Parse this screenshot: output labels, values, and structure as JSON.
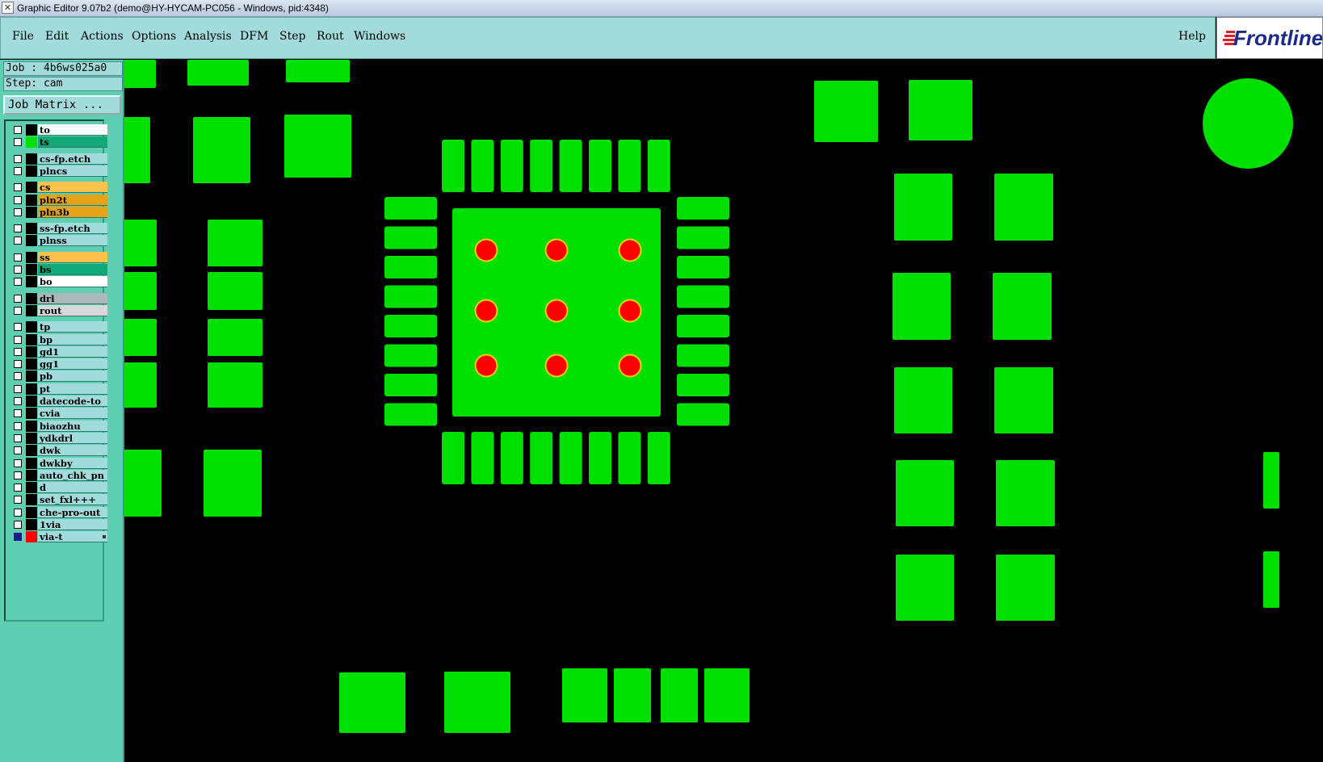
{
  "window": {
    "title": "Graphic Editor 9.07b2 (demo@HY-HYCAM-PC056 - Windows, pid:4348)"
  },
  "menubar": {
    "items": [
      "File",
      "Edit",
      "Actions",
      "Options",
      "Analysis",
      "DFM",
      "Step",
      "Rout",
      "Windows"
    ],
    "help": "Help"
  },
  "logo": {
    "text": "Frontline"
  },
  "sidebar": {
    "job_label": "Job :",
    "job_value": "4b6ws025a0",
    "step_label": "Step:",
    "step_value": "cam",
    "job_matrix_button": "Job Matrix ..."
  },
  "layers": [
    {
      "name": "to",
      "color": "#ffffff",
      "checked": false
    },
    {
      "name": "ts",
      "color": "#13a878",
      "checked": false
    },
    {
      "name": "cs-fp.etch",
      "color": "#a1dbdb",
      "checked": false
    },
    {
      "name": "plncs",
      "color": "#a1dbdb",
      "checked": false
    },
    {
      "name": "cs",
      "color": "#ffc34d",
      "checked": false
    },
    {
      "name": "pln2t",
      "color": "#e7a317",
      "checked": false
    },
    {
      "name": "pln3b",
      "color": "#e7a317",
      "checked": false
    },
    {
      "name": "ss-fp.etch",
      "color": "#a1dbdb",
      "checked": false
    },
    {
      "name": "plnss",
      "color": "#a1dbdb",
      "checked": false
    },
    {
      "name": "ss",
      "color": "#ffc34d",
      "checked": false
    },
    {
      "name": "bs",
      "color": "#13a878",
      "checked": false
    },
    {
      "name": "bo",
      "color": "#ffffff",
      "checked": false
    },
    {
      "name": "drl",
      "color": "#a9b8b8",
      "checked": false
    },
    {
      "name": "rout",
      "color": "#d8d8d8",
      "checked": false
    },
    {
      "name": "tp",
      "color": "#a1dbdb",
      "checked": false
    },
    {
      "name": "bp",
      "color": "#a1dbdb",
      "checked": false
    },
    {
      "name": "gd1",
      "color": "#a1dbdb",
      "checked": false
    },
    {
      "name": "gg1",
      "color": "#a1dbdb",
      "checked": false
    },
    {
      "name": "pb",
      "color": "#a1dbdb",
      "checked": false
    },
    {
      "name": "pt",
      "color": "#a1dbdb",
      "checked": false
    },
    {
      "name": "datecode-to",
      "color": "#a1dbdb",
      "checked": false
    },
    {
      "name": "cvia",
      "color": "#a1dbdb",
      "checked": false
    },
    {
      "name": "biaozhu",
      "color": "#a1dbdb",
      "checked": false
    },
    {
      "name": "ydkdrl",
      "color": "#a1dbdb",
      "checked": false
    },
    {
      "name": "dwk",
      "color": "#a1dbdb",
      "checked": false
    },
    {
      "name": "dwkby",
      "color": "#a1dbdb",
      "checked": false
    },
    {
      "name": "auto_chk_pn",
      "color": "#a1dbdb",
      "checked": false
    },
    {
      "name": "d",
      "color": "#a1dbdb",
      "checked": false
    },
    {
      "name": "set_fxl+++",
      "color": "#a1dbdb",
      "checked": false
    },
    {
      "name": "che-pro-out",
      "color": "#a1dbdb",
      "checked": false
    },
    {
      "name": "1via",
      "color": "#a1dbdb",
      "checked": false
    },
    {
      "name": "via-t",
      "color": "#a1dbdb",
      "checked": true
    }
  ],
  "colors": {
    "pad": "#00e000",
    "via_hole": "#ff0000",
    "via_ring": "#f0d000",
    "background": "#000000",
    "active_layer_swatch": "#ff0000",
    "displayed_layer_swatch": "#00e000"
  }
}
